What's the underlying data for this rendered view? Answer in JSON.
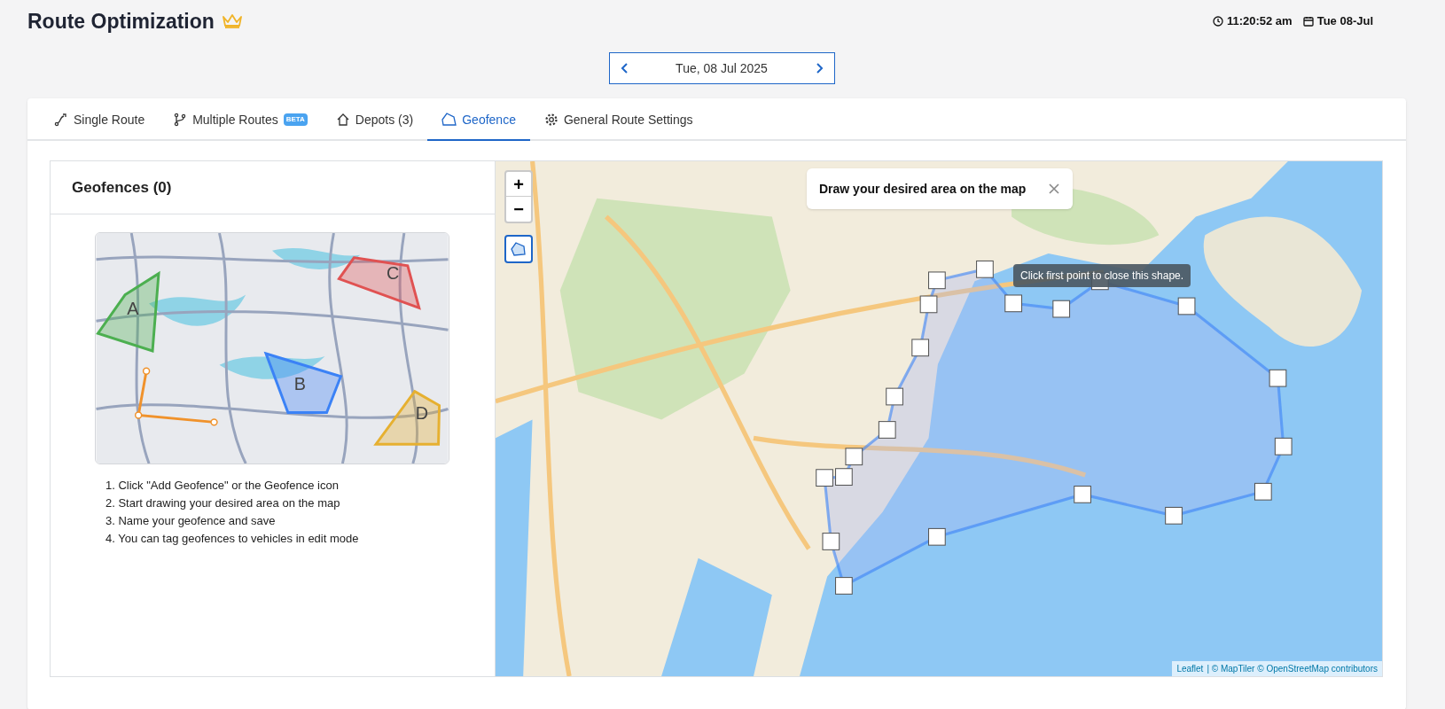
{
  "header": {
    "title": "Route Optimization",
    "time": "11:20:52 am",
    "date": "Tue 08-Jul"
  },
  "date_picker": {
    "value": "Tue, 08 Jul 2025"
  },
  "tabs": [
    {
      "label": "Single Route",
      "kind": "route",
      "selected": false
    },
    {
      "label": "Multiple Routes",
      "kind": "branch",
      "badge": "BETA",
      "selected": false
    },
    {
      "label": "Depots (3)",
      "kind": "home",
      "selected": false
    },
    {
      "label": "Geofence",
      "kind": "geofence",
      "selected": true
    },
    {
      "label": "General Route Settings",
      "kind": "gear",
      "selected": false
    }
  ],
  "geofences_panel": {
    "title": "Geofences (0)",
    "illustration_shapes": [
      {
        "label": "A",
        "color": "#4caf50"
      },
      {
        "label": "B",
        "color": "#3b82f6"
      },
      {
        "label": "C",
        "color": "#e05252"
      },
      {
        "label": "D",
        "color": "#e6b030"
      }
    ],
    "steps": [
      "1. Click \"Add Geofence\" or the Geofence icon",
      "2. Start drawing your desired area on the map",
      "3. Name your geofence and save",
      "4. You can tag geofences to vehicles in edit mode"
    ]
  },
  "map": {
    "zoom_in": "+",
    "zoom_out": "−",
    "draw_tool_selected": true,
    "popup": "Draw your desired area on the map",
    "tooltip": "Click first point to close this shape.",
    "attribution_link": "Leaflet",
    "attribution_text": "| © MapTiler © OpenStreetMap contributors"
  }
}
